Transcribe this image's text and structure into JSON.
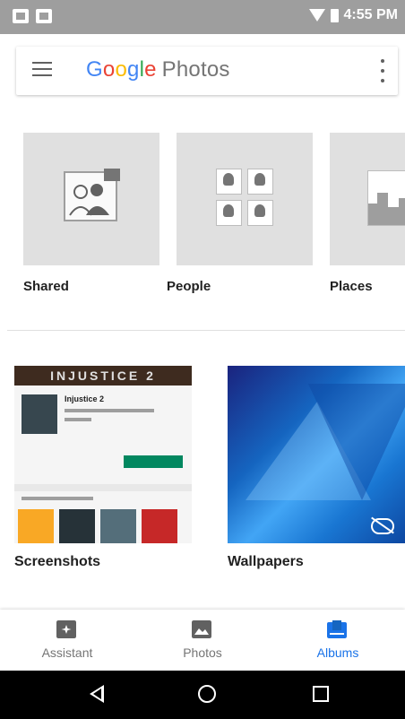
{
  "status_bar": {
    "time": "4:55 PM"
  },
  "app_bar": {
    "logo_google": [
      "G",
      "o",
      "o",
      "g",
      "l",
      "e"
    ],
    "logo_photos": "Photos"
  },
  "categories": [
    {
      "label": "Shared"
    },
    {
      "label": "People"
    },
    {
      "label": "Places"
    }
  ],
  "albums": [
    {
      "label": "Screenshots",
      "banner": "INJUSTICE 2",
      "app_title": "Injustice 2"
    },
    {
      "label": "Wallpapers"
    }
  ],
  "bottom_nav": [
    {
      "label": "Assistant",
      "icon": "assistant-icon",
      "active": false
    },
    {
      "label": "Photos",
      "icon": "photos-icon",
      "active": false
    },
    {
      "label": "Albums",
      "icon": "albums-icon",
      "active": true
    }
  ],
  "colors": {
    "status_bar": "#9e9e9e",
    "accent": "#1a73e8",
    "google_blue": "#4285f4",
    "google_red": "#ea4335",
    "google_yellow": "#fbbc05",
    "google_green": "#34a853"
  }
}
